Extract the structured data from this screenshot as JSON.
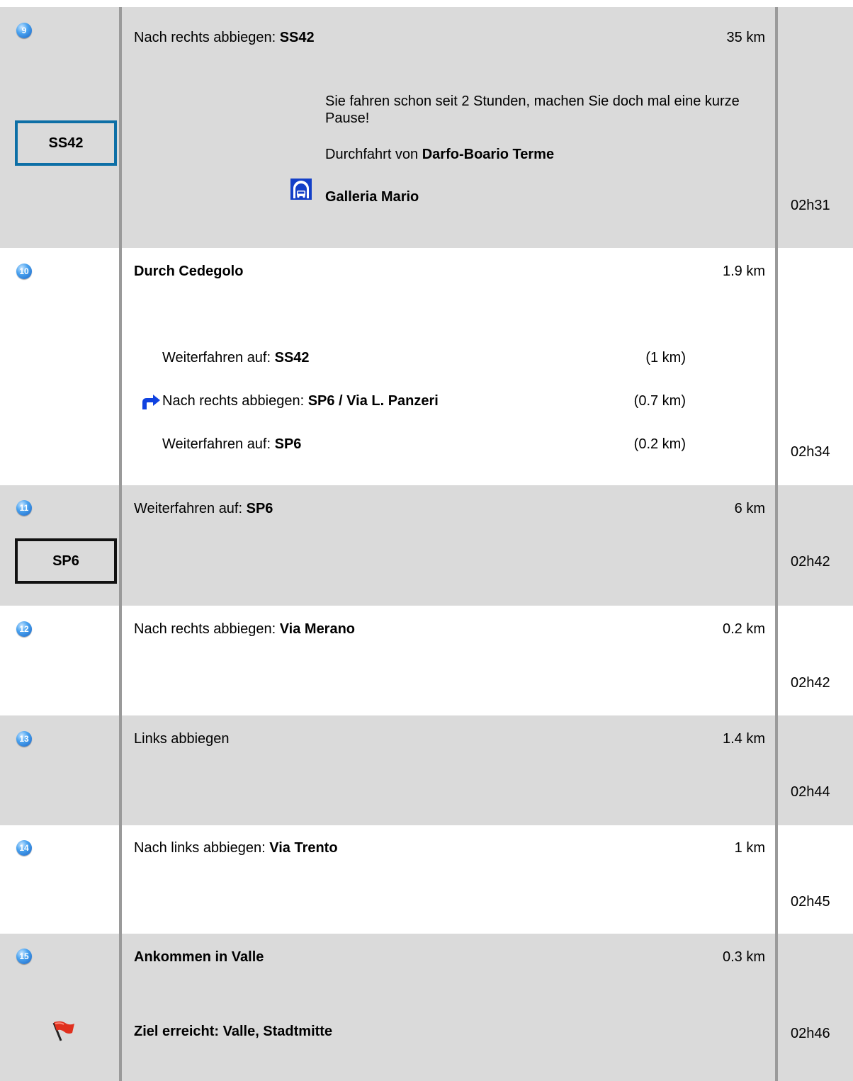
{
  "steps": [
    {
      "number": "9",
      "title_prefix": "Nach rechts abbiegen: ",
      "title_bold": "SS42",
      "distance": "35 km",
      "time": "02h31",
      "sign": "SS42",
      "notice": "Sie fahren schon seit 2 Stunden, machen Sie doch mal eine kurze Pause!",
      "pass_prefix": "Durchfahrt von ",
      "pass_bold": "Darfo-Boario Terme",
      "tunnel_label": "Galleria Mario",
      "tunnel_icon": "tunnel-icon"
    },
    {
      "number": "10",
      "title_bold": "Durch Cedegolo",
      "distance": "1.9 km",
      "time": "02h34",
      "substeps": [
        {
          "prefix": "Weiterfahren auf: ",
          "bold": "SS42",
          "distance": "(1 km)"
        },
        {
          "prefix": "Nach rechts abbiegen: ",
          "bold": "SP6 / Via L. Panzeri",
          "distance": "(0.7 km)",
          "icon": "turn-right-arrow-icon"
        },
        {
          "prefix": "Weiterfahren auf: ",
          "bold": "SP6",
          "distance": "(0.2 km)"
        }
      ]
    },
    {
      "number": "11",
      "title_prefix": "Weiterfahren auf: ",
      "title_bold": "SP6",
      "distance": "6 km",
      "time": "02h42",
      "sign": "SP6"
    },
    {
      "number": "12",
      "title_prefix": "Nach rechts abbiegen: ",
      "title_bold": "Via Merano",
      "distance": "0.2 km",
      "time": "02h42"
    },
    {
      "number": "13",
      "title_prefix": "Links abbiegen",
      "distance": "1.4 km",
      "time": "02h44"
    },
    {
      "number": "14",
      "title_prefix": "Nach links abbiegen: ",
      "title_bold": "Via Trento",
      "distance": "1 km",
      "time": "02h45"
    },
    {
      "number": "15",
      "title_bold": "Ankommen in Valle",
      "distance": "0.3 km",
      "time": "02h46",
      "destination": "Ziel erreicht: Valle, Stadtmitte",
      "destination_icon": "destination-flag-icon"
    }
  ],
  "colors": {
    "row_grey": "#dadada",
    "divider": "#9a9a9a",
    "sign_blue": "#0d6fa6",
    "badge_blue": "#1a63c4",
    "flag_red": "#e0301e"
  }
}
